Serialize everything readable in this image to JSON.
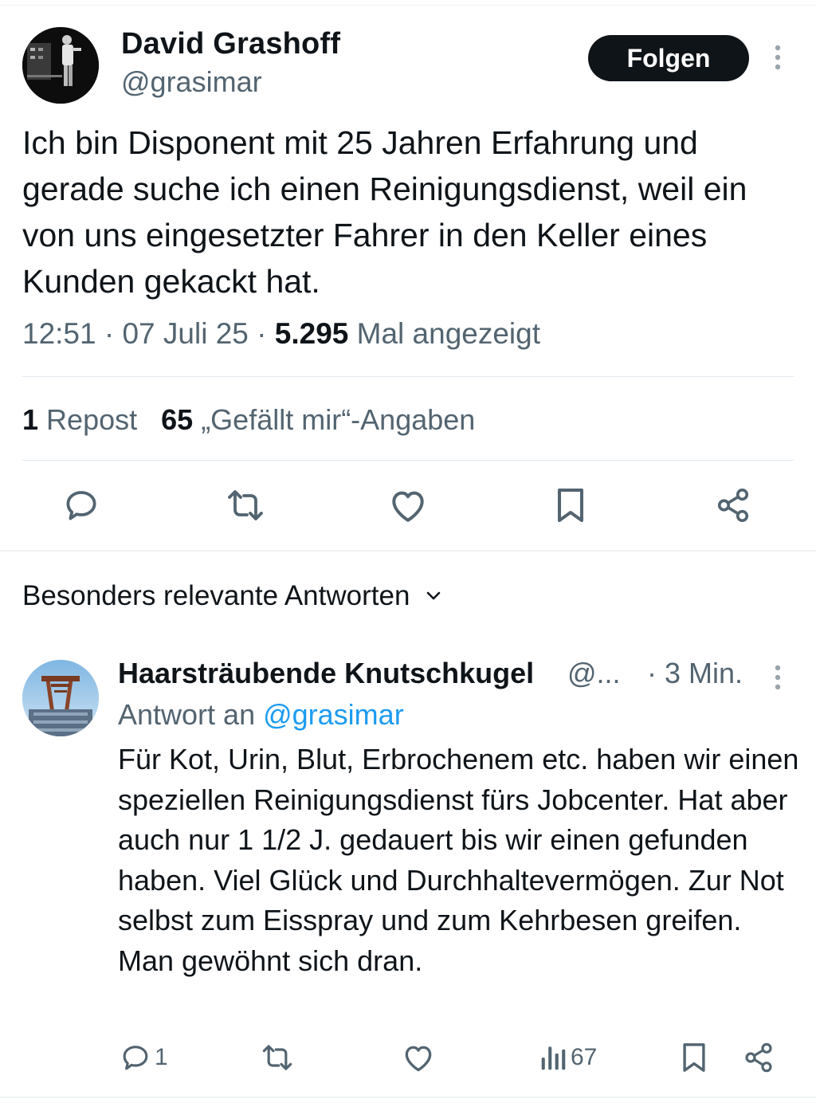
{
  "tweet": {
    "author_name": "David Grashoff",
    "author_handle": "@grasimar",
    "follow_label": "Folgen",
    "text": "Ich bin Disponent mit 25 Jahren Erfahrung und gerade suche ich einen Reinigungsdienst, weil ein von uns eingesetzter Fahrer in den Keller eines Kunden gekackt hat.",
    "time": "12:51",
    "date": "07 Juli 25",
    "views_count": "5.295",
    "views_label": "Mal angezeigt",
    "repost_count": "1",
    "repost_label": "Repost",
    "like_count": "65",
    "like_label": "„Gefällt mir“-Angaben",
    "actions": [
      "reply-icon",
      "repost-icon",
      "like-icon",
      "bookmark-icon",
      "share-icon"
    ]
  },
  "replies_sort": {
    "label": "Besonders relevante Antworten"
  },
  "reply": {
    "author_name": "Haarsträubende Knutschkugel",
    "author_handle": "@...",
    "time": "· 3 Min.",
    "reply_to_prefix": "Antwort an",
    "reply_to_handle": "@grasimar",
    "text": "Für Kot, Urin, Blut, Erbrochenem etc. haben wir einen speziellen Reinigungsdienst fürs Jobcenter. Hat aber auch nur 1 1/2 J. gedauert bis wir einen gefunden haben. Viel Glück und Durchhaltevermögen. Zur Not selbst zum Eisspray und zum Kehrbesen greifen. Man gewöhnt sich dran.",
    "reply_count": "1",
    "views_count": "67"
  },
  "colors": {
    "text": "#0f1419",
    "secondary": "#536471",
    "link": "#1d9bf0",
    "divider": "#eff3f4"
  }
}
